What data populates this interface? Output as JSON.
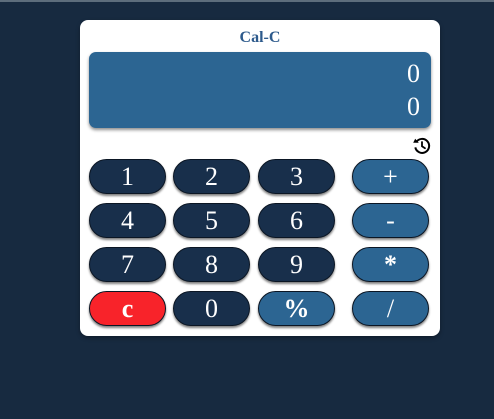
{
  "app": {
    "title": "Cal-C"
  },
  "display": {
    "expression": "0",
    "result": "0"
  },
  "history": {
    "icon": "history-icon"
  },
  "keys": {
    "one": "1",
    "two": "2",
    "three": "3",
    "plus": "+",
    "four": "4",
    "five": "5",
    "six": "6",
    "minus": "-",
    "seven": "7",
    "eight": "8",
    "nine": "9",
    "multiply": "*",
    "clear": "c",
    "zero": "0",
    "percent": "%",
    "divide": "/"
  },
  "colors": {
    "background": "#172a40",
    "panel": "#ffffff",
    "display": "#2c6592",
    "number_key": "#182f4b",
    "operator_key": "#2c6592",
    "clear_key": "#f8232a",
    "title": "#2d5a8c"
  }
}
